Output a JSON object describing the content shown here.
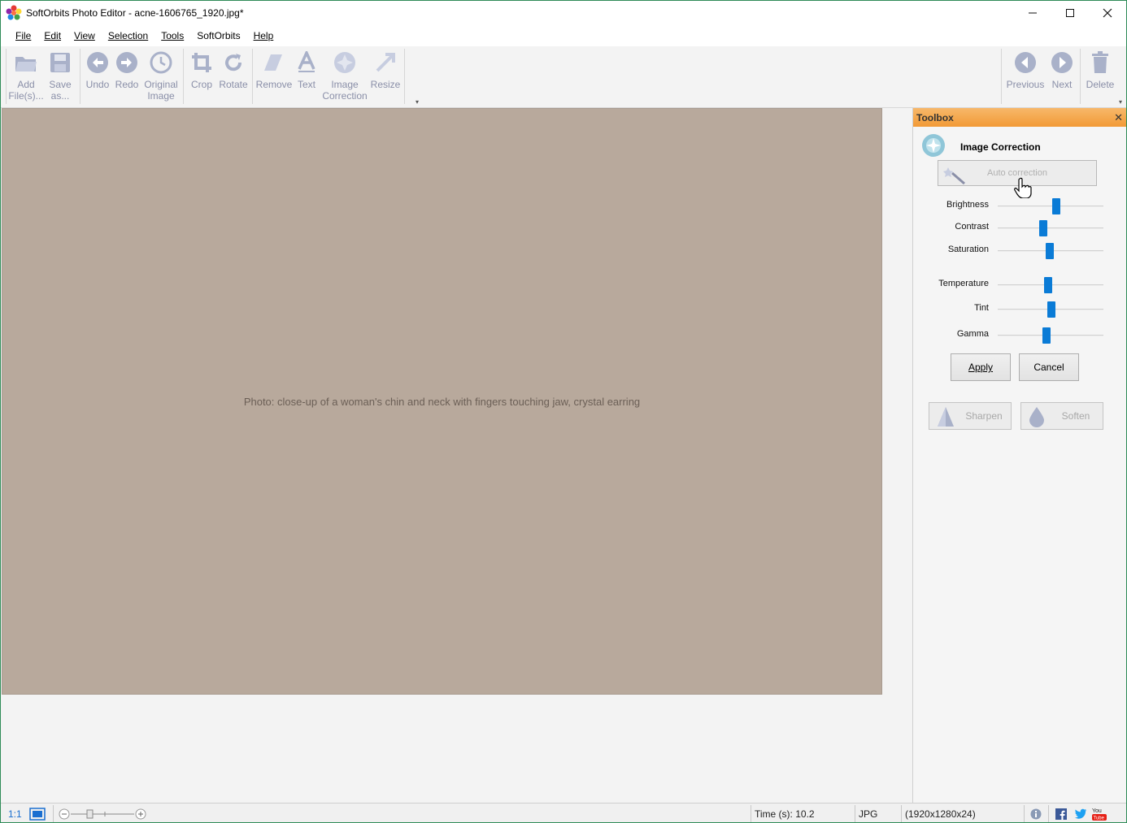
{
  "window": {
    "title": "SoftOrbits Photo Editor - acne-1606765_1920.jpg*",
    "controls": [
      "minimize",
      "maximize",
      "close"
    ]
  },
  "menu": {
    "items": [
      {
        "label": "File"
      },
      {
        "label": "Edit"
      },
      {
        "label": "View"
      },
      {
        "label": "Selection"
      },
      {
        "label": "Tools"
      },
      {
        "label": "SoftOrbits"
      },
      {
        "label": "Help"
      }
    ]
  },
  "toolbar": {
    "buttons": [
      {
        "label": "Add\nFile(s)...",
        "icon": "folder-open-icon"
      },
      {
        "label": "Save\nas...",
        "icon": "save-icon"
      },
      {
        "label": "Undo",
        "icon": "undo-icon"
      },
      {
        "label": "Redo",
        "icon": "redo-icon"
      },
      {
        "label": "Original\nImage",
        "icon": "original-image-icon"
      },
      {
        "label": "Crop",
        "icon": "crop-icon"
      },
      {
        "label": "Rotate",
        "icon": "rotate-icon"
      },
      {
        "label": "Remove",
        "icon": "eraser-icon"
      },
      {
        "label": "Text",
        "icon": "text-icon"
      },
      {
        "label": "Image\nCorrection",
        "icon": "image-correction-icon"
      },
      {
        "label": "Resize",
        "icon": "resize-icon"
      }
    ],
    "nav_buttons": [
      {
        "label": "Previous",
        "icon": "previous-icon"
      },
      {
        "label": "Next",
        "icon": "next-icon"
      },
      {
        "label": "Delete",
        "icon": "trash-icon"
      }
    ]
  },
  "toolbox": {
    "title": "Toolbox",
    "section_title": "Image Correction",
    "auto_correction_label": "Auto correction",
    "sliders": [
      {
        "label": "Brightness",
        "value": 0.55
      },
      {
        "label": "Contrast",
        "value": 0.43
      },
      {
        "label": "Saturation",
        "value": 0.49
      },
      {
        "label": "Temperature",
        "value": 0.48
      },
      {
        "label": "Tint",
        "value": 0.51
      },
      {
        "label": "Gamma",
        "value": 0.46
      }
    ],
    "apply_label": "Apply",
    "cancel_label": "Cancel",
    "sharpen_label": "Sharpen",
    "soften_label": "Soften"
  },
  "canvas": {
    "image_alt": "Photo: close-up of a woman's chin and neck with fingers touching jaw, crystal earring"
  },
  "statusbar": {
    "zoom_label": "1:1",
    "time_text": "Time (s): 10.2",
    "format_text": "JPG",
    "dimensions_text": "(1920x1280x24)"
  },
  "colors": {
    "accent_blue": "#0a7bd6",
    "toolbox_header": "#f29a36",
    "toolbar_icon": "#9aa3bf"
  }
}
